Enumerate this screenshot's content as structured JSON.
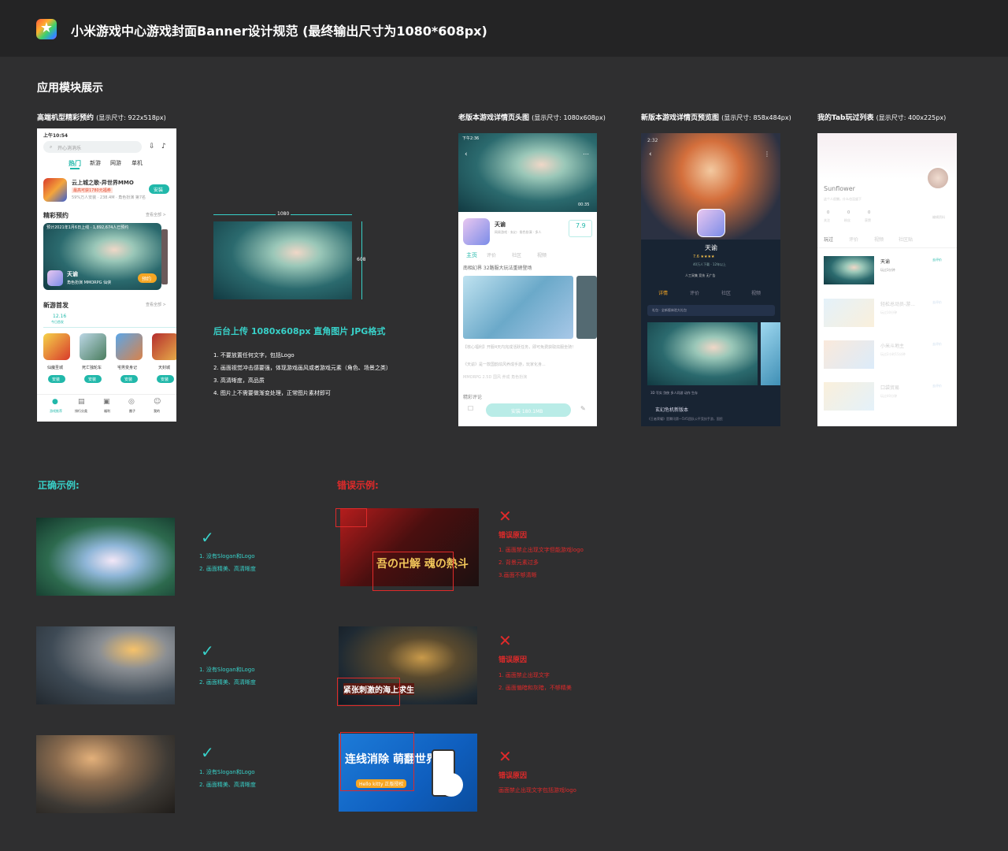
{
  "header": {
    "title": "小米游戏中心游戏封面Banner设计规范 (最终输出尺寸为1080*608px)",
    "app_icon": "star-app-icon"
  },
  "section": {
    "title": "应用模块展示"
  },
  "captions": {
    "c1": {
      "title": "高端机型精彩预约",
      "size": "(显示尺寸: 922x518px)"
    },
    "c2": {
      "title": "老版本游戏详情页头图",
      "size": "(显示尺寸: 1080x608px)"
    },
    "c3": {
      "title": "新版本游戏详情页预览图",
      "size": "(显示尺寸: 858x484px)"
    },
    "c4": {
      "title": "我的Tab玩过列表",
      "size": "(显示尺寸: 400x225px)"
    }
  },
  "phone1": {
    "status": "上午10:54",
    "search": "开心消消乐",
    "tabs": [
      "热门",
      "新游",
      "网游",
      "单机"
    ],
    "featured_game": "云上城之歌-异世界MMO",
    "featured_tag": "最高可获1780元福券",
    "featured_meta": "59%万人安装 · 238.4M · 角色扮演 第7名",
    "install": "安装",
    "section1": "精彩预约",
    "see_all": "查看全部 >",
    "banner_line": "预计2021年1月6日上线 · 1,892,674人已预约",
    "game_name": "天谕",
    "game_tags": [
      "角色扮演",
      "MMORPG",
      "仙侠"
    ],
    "reserve": "预约",
    "section2": "新游首发",
    "date": "12.16",
    "date_sub": "今日首发",
    "games": [
      "仙魔圣城",
      "死亡独轮车",
      "宅男变身记",
      "天封城"
    ],
    "nav": [
      "游戏推荐",
      "排行分类",
      "福利",
      "圈子",
      "我的"
    ]
  },
  "center": {
    "width_label": "1080",
    "height_label": "608",
    "upload": "后台上传  1080x608px   直角图片   JPG格式",
    "rules": [
      "1. 不要放置任何文字，包括Logo",
      "2. 画面视觉冲击感要强，体现游戏画风或者游戏元素（角色、场景之类）",
      "3. 高清晰度，高品质",
      "4. 图片上不需要做渐变处理，正常图片素材即可"
    ]
  },
  "phone2": {
    "status": "下午2:36",
    "time": "00:35",
    "name": "天谕",
    "meta": "网易游戏 · 玄幻 · 角色扮演 · 多人",
    "score": "7.9",
    "tabs": [
      "主页",
      "评价",
      "社区",
      "视频"
    ],
    "headline": "南相幻界 32路服大玩法重磅登场",
    "desc1": "【核心福利】开服4天内完成活跃任务，即可免费获取炫服坐骑！",
    "desc2": "《天谕》是一款国韵炫风养成手游，玩家化身...",
    "chips": [
      "MMORPG",
      "2.5D",
      "国风",
      "养成",
      "角色扮演"
    ],
    "review": "精彩评论",
    "install": "安装 180.1MB"
  },
  "phone3": {
    "status": "2:32",
    "name": "天谕",
    "rating": "7.6 ★★★★",
    "meta": "40万人下载 · 12年以上",
    "tags": [
      "人工采集",
      "竞技",
      "无广告"
    ],
    "tabs": [
      "详情",
      "评价",
      "社区",
      "视频"
    ],
    "gift": "礼包 · 全新版体验大礼包",
    "chips": [
      "3D",
      "写实",
      "剑侠",
      "多人同游",
      "动作",
      "生存"
    ],
    "news_title": "玄幻危机新版本",
    "news_body": "《王者荣耀》是腾讯第一5V5团队公平竞技手游，国民"
  },
  "phone4": {
    "user": "Sunflower",
    "bio": "这个人很懒，什么也没留下",
    "stats": [
      "关注",
      "粉丝",
      "获赞"
    ],
    "stat_values": [
      "0",
      "0",
      "0"
    ],
    "edit": "编辑资料",
    "tabs": [
      "玩过",
      "评价",
      "视频",
      "社区贴"
    ],
    "items": [
      {
        "name": "天谕",
        "time": "玩过3分钟"
      },
      {
        "name": "轻松总动员-游...",
        "time": "玩过10分钟"
      },
      {
        "name": "小米斗地主",
        "time": "玩过2小时15分钟"
      },
      {
        "name": "口袋贸易",
        "time": "玩过40分钟"
      }
    ],
    "action": "去评价"
  },
  "examples": {
    "good_title": "正确示例:",
    "bad_title": "错误示例:",
    "good": [
      {
        "notes": [
          "1. 没有Slogan和Logo",
          "2. 画面精美、高清晰度"
        ]
      },
      {
        "notes": [
          "1. 没有Slogan和Logo",
          "2. 画面精美、高清晰度"
        ]
      },
      {
        "notes": [
          "1. 没有Slogan和Logo",
          "2. 画面精美、高清晰度"
        ]
      }
    ],
    "bad_head": "错误原因",
    "bad": [
      {
        "notes": [
          "1. 画面禁止出现文字但能游戏logo",
          "2. 背景元素过多",
          "3.画面不够清晰"
        ],
        "art_text": "吾の卍解 魂の熱斗"
      },
      {
        "notes": [
          "1. 画面禁止出现文字",
          "2. 画面偏暗和灰暗，不够精美"
        ],
        "art_text": "紧张刺激的海上求生"
      },
      {
        "notes": [
          "画面禁止出现文字包括游戏logo"
        ],
        "art_text": "连线消除 萌翻世界",
        "art_sub": "Hello kitty 正版授权"
      }
    ]
  },
  "colors": {
    "accent": "#38d1c9",
    "error": "#e02a2a",
    "bg": "#2f2f30",
    "header": "#242425"
  }
}
